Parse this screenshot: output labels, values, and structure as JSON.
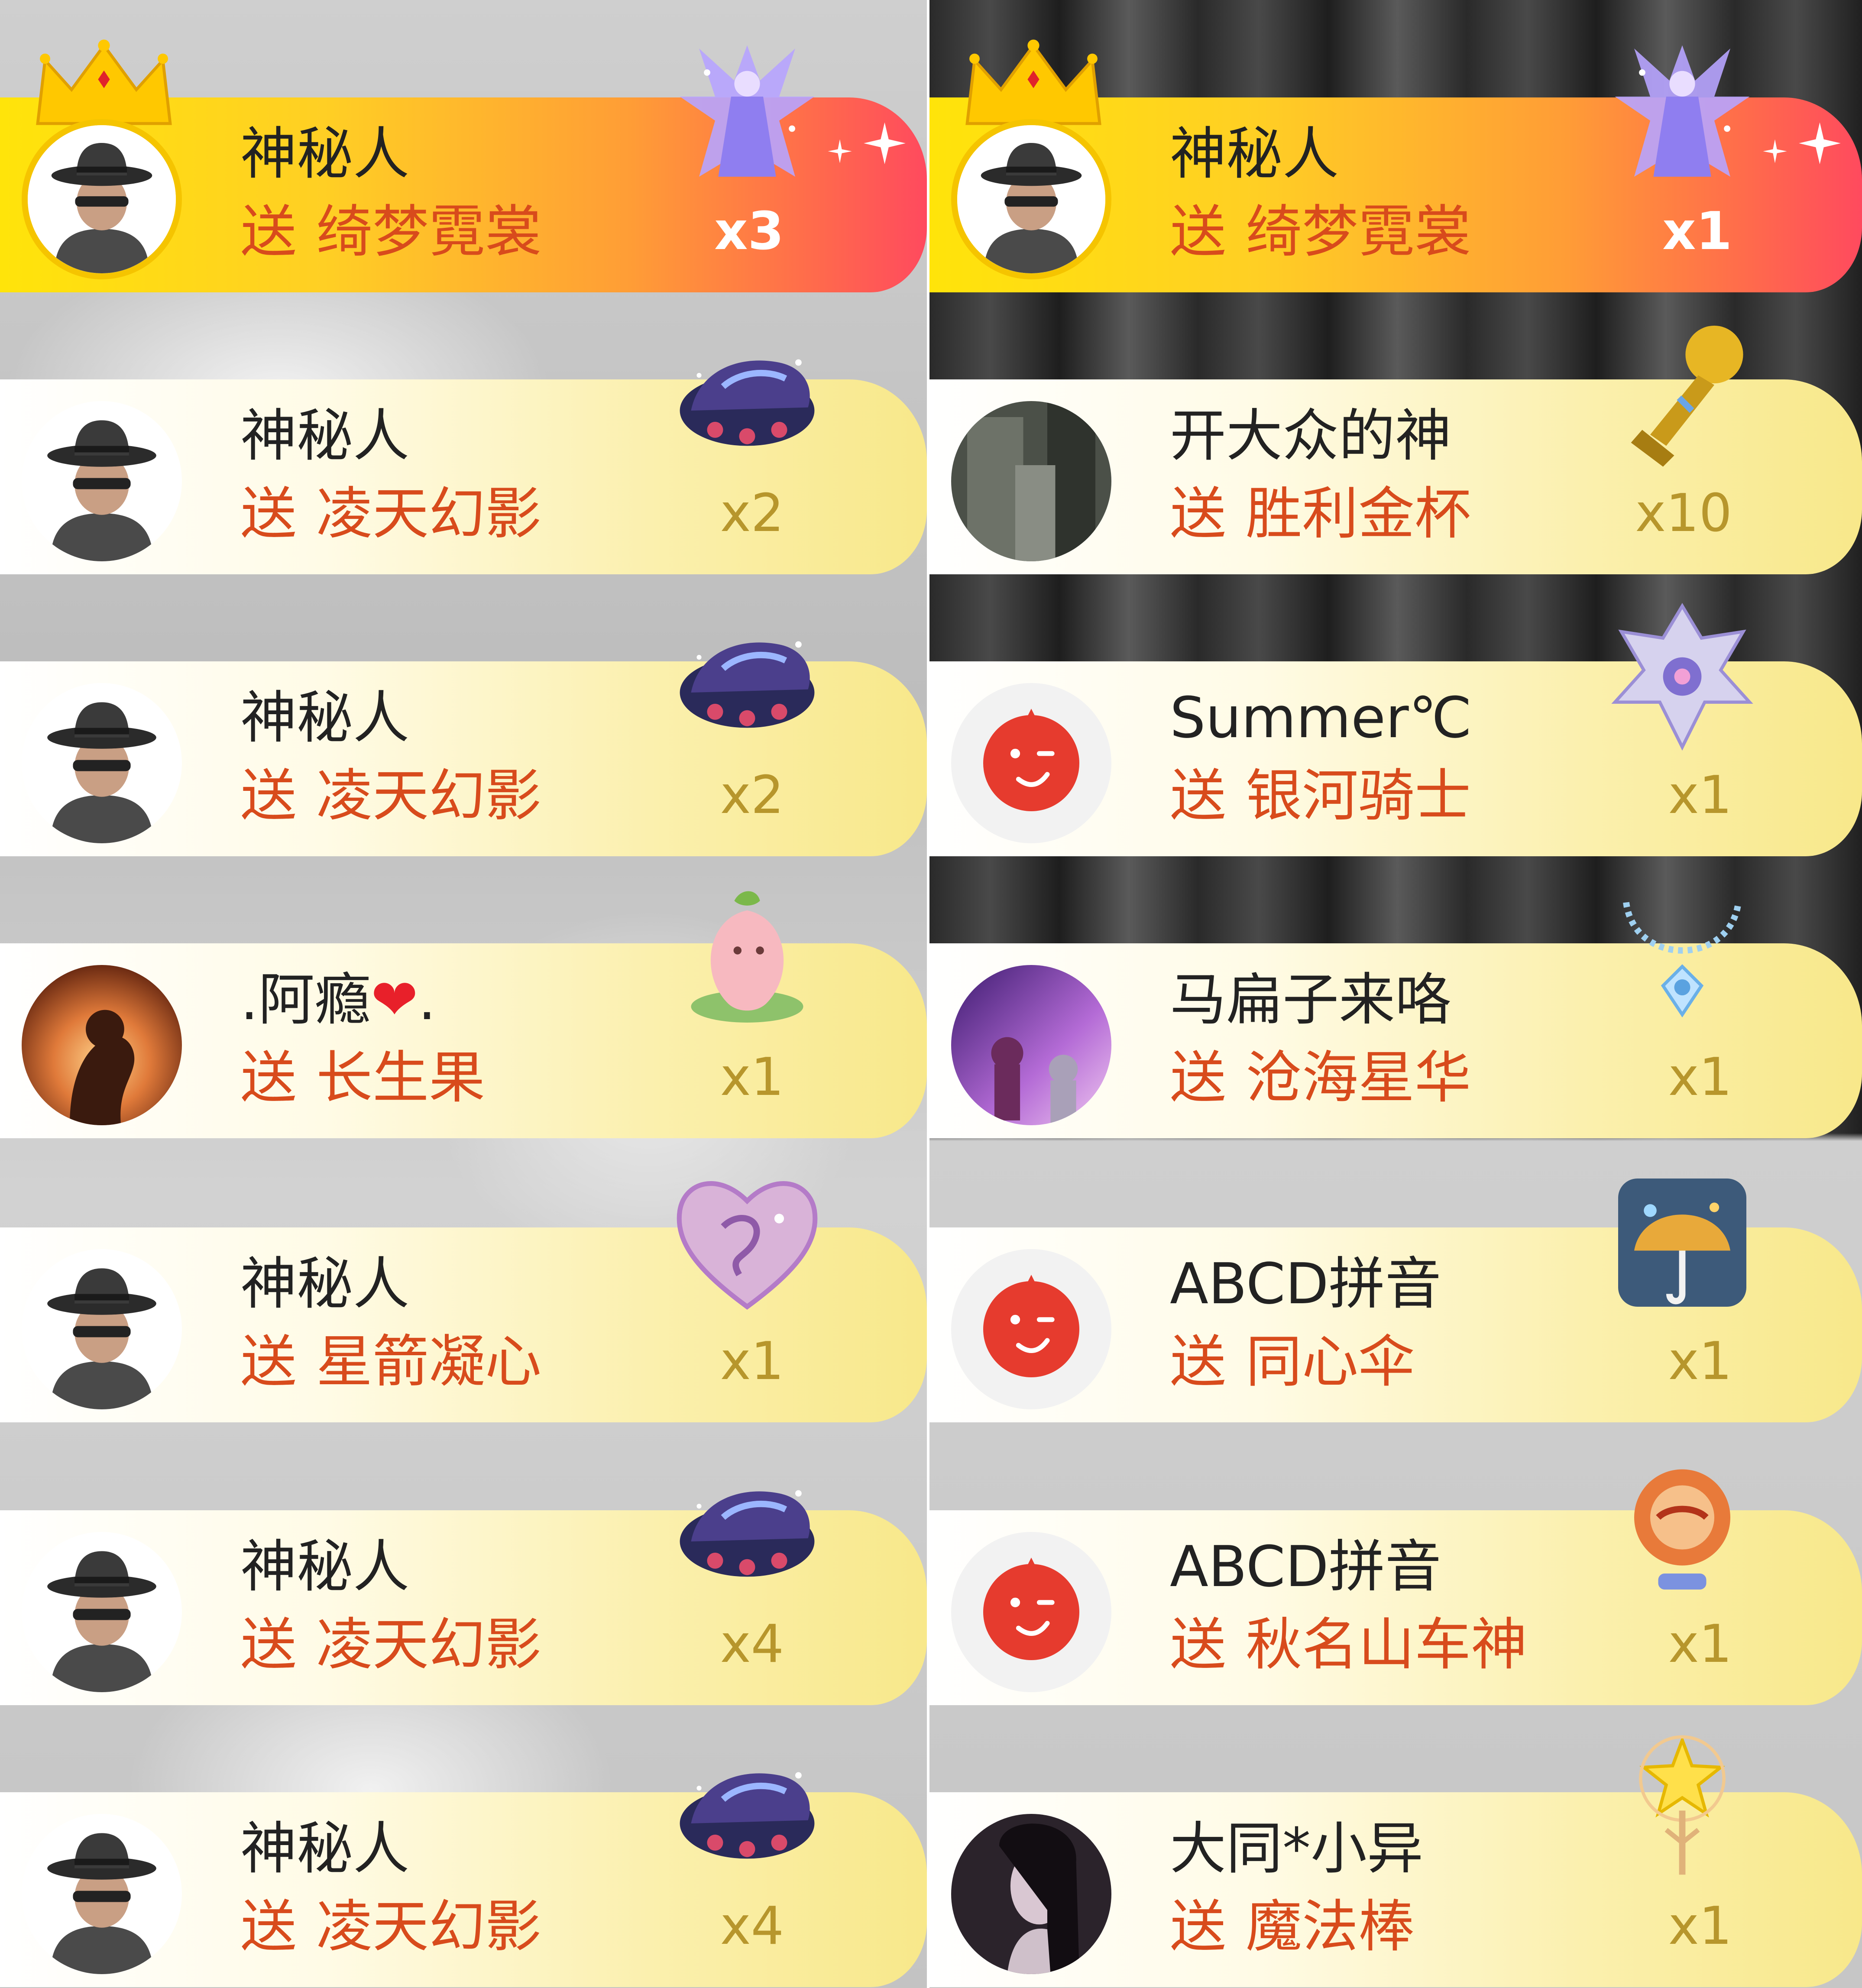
{
  "columns": [
    {
      "rows": [
        {
          "top": true,
          "name": "神秘人",
          "prefix": "送",
          "gift": "绮梦霓裳",
          "count": "x3",
          "avatar": "mystery-avatar",
          "gift_icon": "fantasy-dress-gift-icon"
        },
        {
          "top": false,
          "name": "神秘人",
          "prefix": "送",
          "gift": "凌天幻影",
          "count": "x2",
          "avatar": "mystery-avatar",
          "gift_icon": "sports-car-gift-icon"
        },
        {
          "top": false,
          "name": "神秘人",
          "prefix": "送",
          "gift": "凌天幻影",
          "count": "x2",
          "avatar": "mystery-avatar",
          "gift_icon": "sports-car-gift-icon"
        },
        {
          "top": false,
          "name": ".阿瘾",
          "name_heart": "❤",
          "name_suffix": ".",
          "prefix": "送",
          "gift": "长生果",
          "count": "x1",
          "avatar": "sunset-photo-avatar",
          "gift_icon": "peach-fruit-gift-icon"
        },
        {
          "top": false,
          "name": "神秘人",
          "prefix": "送",
          "gift": "星箭凝心",
          "count": "x1",
          "avatar": "mystery-avatar",
          "gift_icon": "crystal-heart-gift-icon"
        },
        {
          "top": false,
          "name": "神秘人",
          "prefix": "送",
          "gift": "凌天幻影",
          "count": "x4",
          "avatar": "mystery-avatar",
          "gift_icon": "sports-car-gift-icon"
        },
        {
          "top": false,
          "name": "神秘人",
          "prefix": "送",
          "gift": "凌天幻影",
          "count": "x4",
          "avatar": "mystery-avatar",
          "gift_icon": "sports-car-gift-icon"
        }
      ]
    },
    {
      "rows": [
        {
          "top": true,
          "name": "神秘人",
          "prefix": "送",
          "gift": "绮梦霓裳",
          "count": "x1",
          "avatar": "mystery-avatar",
          "gift_icon": "fantasy-dress-gift-icon"
        },
        {
          "top": false,
          "name": "开大众的神",
          "prefix": "送",
          "gift": "胜利金杯",
          "count": "x10",
          "avatar": "dark-photo-avatar",
          "gift_icon": "golden-cup-gift-icon"
        },
        {
          "top": false,
          "name": "Summer℃",
          "prefix": "送",
          "gift": "银河骑士",
          "count": "x1",
          "avatar": "red-wink-face-avatar",
          "gift_icon": "galaxy-knight-gift-icon"
        },
        {
          "top": false,
          "name": "马扁子来咯",
          "prefix": "送",
          "gift": "沧海星华",
          "count": "x1",
          "avatar": "purple-scene-avatar",
          "gift_icon": "necklace-gift-icon"
        },
        {
          "top": false,
          "name": "ABCD拼音",
          "prefix": "送",
          "gift": "同心伞",
          "count": "x1",
          "avatar": "red-wink-face-avatar",
          "gift_icon": "umbrella-gift-icon"
        },
        {
          "top": false,
          "name": "ABCD拼音",
          "prefix": "送",
          "gift": "秋名山车神",
          "count": "x1",
          "avatar": "red-wink-face-avatar",
          "gift_icon": "racing-badge-gift-icon"
        },
        {
          "top": false,
          "name": "大同*小异",
          "prefix": "送",
          "gift": "魔法棒",
          "count": "x1",
          "avatar": "portrait-photo-avatar",
          "gift_icon": "magic-wand-gift-icon"
        }
      ]
    }
  ],
  "colors": {
    "name_text": "#222222",
    "gift_text": "#d84b1c",
    "count_text": "#b7962c",
    "top_gradient_start": "#ffe40a",
    "top_gradient_end": "#ff4a5e",
    "row_gradient_end": "#f8e88a"
  }
}
